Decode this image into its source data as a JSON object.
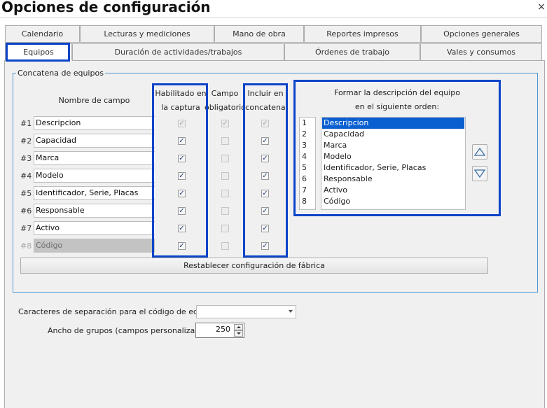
{
  "window": {
    "title": "Opciones de configuración",
    "close_label": "×"
  },
  "tabs_row1": [
    "Calendario",
    "Lecturas y mediciones",
    "Mano de obra",
    "Reportes impresos",
    "Opciones generales"
  ],
  "tabs_row2": [
    "Equipos",
    "Duración de actividades/trabajos",
    "Órdenes de trabajo",
    "Vales y consumos"
  ],
  "active_tab": "Equipos",
  "concat_group": {
    "title": "Concatena de equipos",
    "headers": {
      "field_name": "Nombre de campo",
      "enabled_line1": "Habilitado en",
      "enabled_line2": "la captura",
      "required_line1": "Campo",
      "required_line2": "obligatorio",
      "include_line1": "Incluir en",
      "include_line2": "concatena"
    },
    "rows": [
      {
        "num": "#1",
        "field": "Descripcion",
        "enabled": true,
        "required": true,
        "include": true,
        "locked": true
      },
      {
        "num": "#2",
        "field": "Capacidad",
        "enabled": true,
        "required": false,
        "include": true,
        "locked": false
      },
      {
        "num": "#3",
        "field": "Marca",
        "enabled": true,
        "required": false,
        "include": true,
        "locked": false
      },
      {
        "num": "#4",
        "field": "Modelo",
        "enabled": true,
        "required": false,
        "include": true,
        "locked": false
      },
      {
        "num": "#5",
        "field": "Identificador, Serie, Placas",
        "enabled": true,
        "required": false,
        "include": true,
        "locked": false
      },
      {
        "num": "#6",
        "field": "Responsable",
        "enabled": true,
        "required": false,
        "include": true,
        "locked": false
      },
      {
        "num": "#7",
        "field": "Activo",
        "enabled": true,
        "required": false,
        "include": true,
        "locked": false
      },
      {
        "num": "#8",
        "field": "Código",
        "enabled": true,
        "required": false,
        "include": true,
        "locked": false,
        "field_disabled": true
      }
    ],
    "order_panel": {
      "title_line1": "Formar la descripción del equipo",
      "title_line2": "en el siguiente orden:",
      "numbers": [
        "1",
        "2",
        "3",
        "4",
        "5",
        "6",
        "7",
        "8"
      ],
      "items": [
        "Descripcion",
        "Capacidad",
        "Marca",
        "Modelo",
        "Identificador, Serie, Placas",
        "Responsable",
        "Activo",
        "Código"
      ],
      "selected_index": 0
    },
    "reset_button": "Restablecer configuración de fábrica"
  },
  "separator": {
    "label": "Caracteres de separación para el código de equipo:",
    "value": ""
  },
  "group_width": {
    "label": "Ancho de grupos (campos personalizados):",
    "value": "250"
  },
  "colors": {
    "highlight": "#0b44c9",
    "selection": "#0a5fd0",
    "group_border": "#4f95d1",
    "panel_bg": "#f0f0f0"
  },
  "icons": {
    "close": "close-icon",
    "move_up": "triangle-up-icon",
    "move_down": "triangle-down-icon",
    "check": "check-icon"
  }
}
